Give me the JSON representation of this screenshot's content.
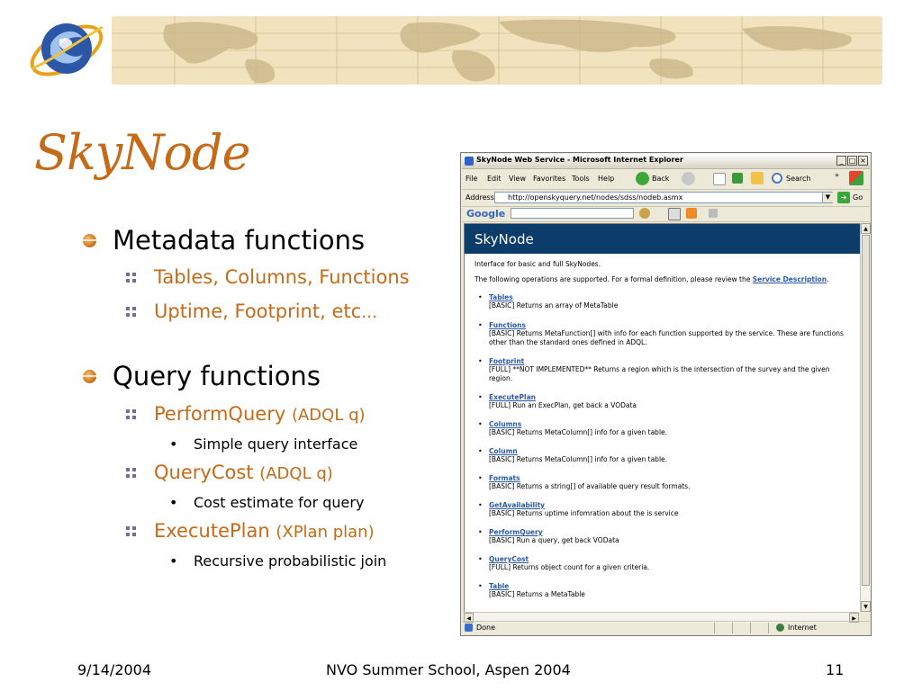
{
  "slide": {
    "title": "SkyNode",
    "colors": {
      "accent": "#c46a18",
      "banner": "#f1e3bd",
      "sub_bullet_marker": "#6e6ea3"
    },
    "bullets": [
      {
        "text": "Metadata functions",
        "children": [
          {
            "text": "Tables, Columns, Functions",
            "param": ""
          },
          {
            "text": "Uptime, Footprint, etc",
            "param": "…"
          }
        ]
      },
      {
        "text": "Query functions",
        "children": [
          {
            "text": "PerformQuery",
            "param": "(ADQL q)",
            "detail": "Simple query interface"
          },
          {
            "text": "QueryCost",
            "param": "(ADQL q)",
            "detail": "Cost estimate for query"
          },
          {
            "text": "ExecutePlan",
            "param": "(XPlan plan)",
            "detail": "Recursive probabilistic join"
          }
        ]
      }
    ]
  },
  "browser": {
    "window_title": "SkyNode Web Service - Microsoft Internet Explorer",
    "menu": [
      "File",
      "Edit",
      "View",
      "Favorites",
      "Tools",
      "Help"
    ],
    "toolbar": {
      "back": "Back",
      "search": "Search",
      "more": "»"
    },
    "address_label": "Address",
    "address_url": "http://openskyquery.net/nodes/sdss/nodeb.asmx",
    "go_label": "Go",
    "google_label": "Google",
    "status_left": "Done",
    "status_right": "Internet",
    "page": {
      "header": "SkyNode",
      "intro": "Interface for basic and full SkyNodes.",
      "ops_intro": "The following operations are supported. For a formal definition, please review the",
      "ops_link": "Service Description",
      "operations": [
        {
          "name": "Tables",
          "desc": "[BASIC] Returns an array of MetaTable"
        },
        {
          "name": "Functions",
          "desc": "[BASIC] Returns MetaFunction[] with info for each function supported by the service. These are functions other than the standard ones defined in ADQL."
        },
        {
          "name": "Footprint",
          "desc": "[FULL] **NOT IMPLEMENTED** Returns a region which is the intersection of the survey and the given region."
        },
        {
          "name": "ExecutePlan",
          "desc": "[FULL] Run an ExecPlan, get back a VOData"
        },
        {
          "name": "Columns",
          "desc": "[BASIC] Returns MetaColumn[] info for a given table."
        },
        {
          "name": "Column",
          "desc": "[BASIC] Returns MetaColumn[] info for a given table."
        },
        {
          "name": "Formats",
          "desc": "[BASIC] Returns a string[] of available query result formats."
        },
        {
          "name": "GetAvailability",
          "desc": "[BASIC] Returns uptime infomration about the is service"
        },
        {
          "name": "PerformQuery",
          "desc": "[BASIC] Run a query, get back VOData"
        },
        {
          "name": "QueryCost",
          "desc": "[FULL] Returns object count for a given criteria."
        },
        {
          "name": "Table",
          "desc": "[BASIC] Returns a MetaTable"
        }
      ]
    }
  },
  "footer": {
    "date": "9/14/2004",
    "event": "NVO Summer School, Aspen 2004",
    "page_number": "11"
  }
}
